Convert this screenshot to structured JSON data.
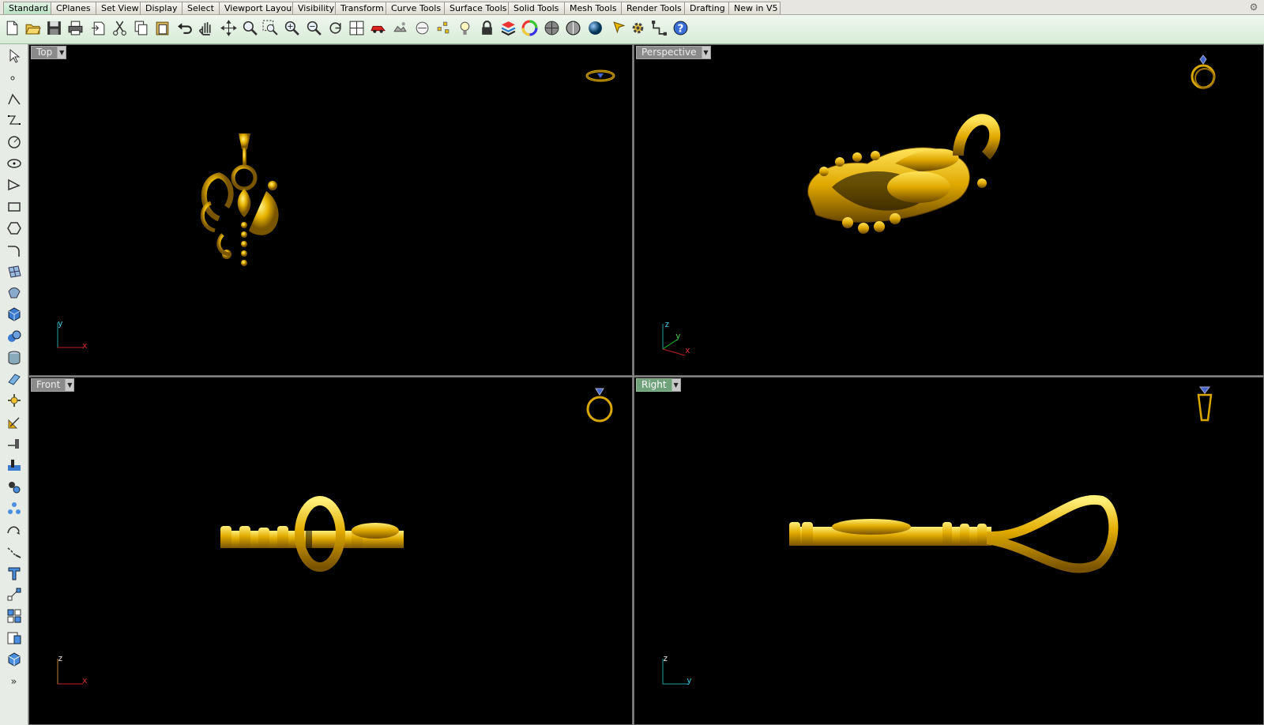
{
  "tabs": [
    "Standard",
    "CPlanes",
    "Set View",
    "Display",
    "Select",
    "Viewport Layout",
    "Visibility",
    "Transform",
    "Curve Tools",
    "Surface Tools",
    "Solid Tools",
    "Mesh Tools",
    "Render Tools",
    "Drafting",
    "New in V5"
  ],
  "active_tab": "Standard",
  "toolbar_icons": [
    "new-icon",
    "open-icon",
    "save-icon",
    "print-icon",
    "import-icon",
    "cut-icon",
    "copy-icon",
    "paste-icon",
    "undo-icon",
    "pan-icon",
    "move-view-icon",
    "zoom-icon",
    "zoom-window-icon",
    "zoom-extents-icon",
    "zoom-selected-icon",
    "rotate-view-icon",
    "four-viewports-icon",
    "car-icon",
    "named-views-icon",
    "cplane-icon",
    "points-icon",
    "light-icon",
    "lock-icon",
    "layer-icon",
    "color-wheel-icon",
    "shaded-icon",
    "rendered-icon",
    "render-sphere-icon",
    "properties-icon",
    "options-icon",
    "snap-icon",
    "help-icon"
  ],
  "left_tools": [
    "select-arrow-icon",
    "point-icon",
    "polyline-icon",
    "curve-icon",
    "circle-icon",
    "ellipse-icon",
    "arc-icon",
    "rectangle-icon",
    "polygon-icon",
    "fillet-icon",
    "surface-icon",
    "sweep-icon",
    "box-icon",
    "sphere-icon",
    "cylinder-icon",
    "extrude-icon",
    "mesh-icon",
    "transform-icon",
    "split-icon",
    "boolean-icon",
    "array-icon",
    "dimension-icon",
    "text-icon",
    "group-icon",
    "block-icon",
    "layout-icon",
    "solid-icon",
    "more-icon"
  ],
  "viewports": {
    "top": {
      "title": "Top",
      "axis1": "y",
      "axis2": "x"
    },
    "perspective": {
      "title": "Perspective",
      "axis1": "z",
      "axis2": "y",
      "axis3": "x"
    },
    "front": {
      "title": "Front",
      "axis1": "z",
      "axis2": "x"
    },
    "right": {
      "title": "Right",
      "axis1": "z",
      "axis2": "y"
    }
  },
  "active_viewport": "Right",
  "colors": {
    "viewport_bg": "#000000",
    "gold": "#d9a700",
    "active_tab": "#b9e2c3",
    "active_viewport_label": "#6fa27b"
  }
}
